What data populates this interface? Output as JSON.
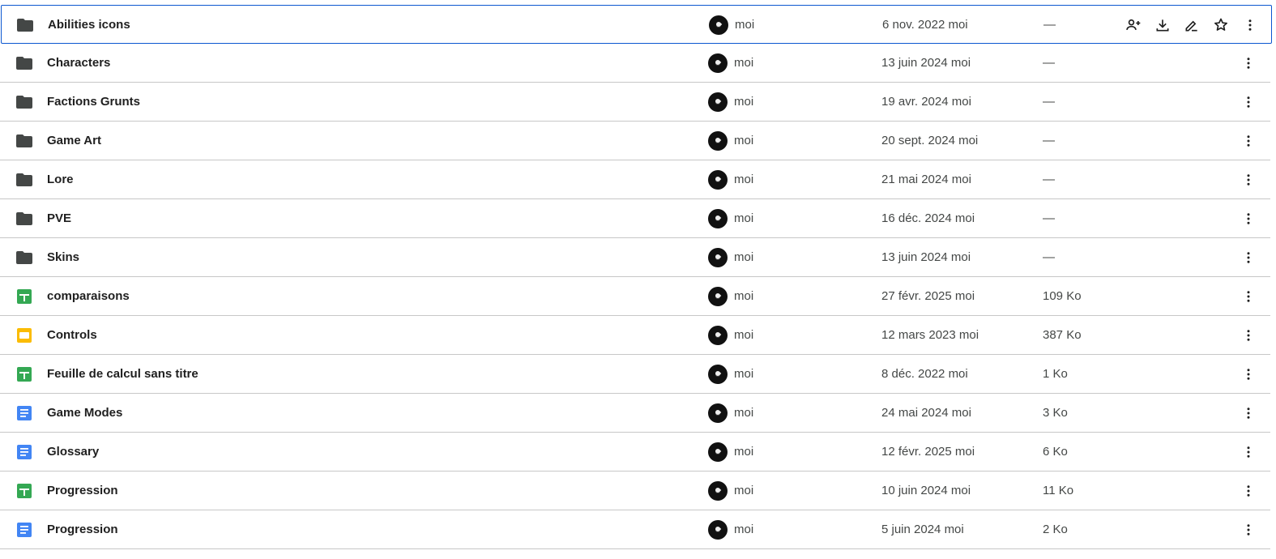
{
  "colors": {
    "folder": "#444746",
    "sheets": "#34a853",
    "slides": "#fbbc04",
    "docs": "#4285f4",
    "selection_border": "#0b57d0"
  },
  "rows": [
    {
      "name": "Abilities icons",
      "type": "folder-icon",
      "owner": "moi",
      "modified": "6 nov. 2022 moi",
      "size": "—",
      "selected": true
    },
    {
      "name": "Characters",
      "type": "folder-icon",
      "owner": "moi",
      "modified": "13 juin 2024 moi",
      "size": "—"
    },
    {
      "name": "Factions Grunts",
      "type": "folder-icon",
      "owner": "moi",
      "modified": "19 avr. 2024 moi",
      "size": "—"
    },
    {
      "name": "Game Art",
      "type": "folder-icon",
      "owner": "moi",
      "modified": "20 sept. 2024 moi",
      "size": "—"
    },
    {
      "name": "Lore",
      "type": "folder-icon",
      "owner": "moi",
      "modified": "21 mai 2024 moi",
      "size": "—"
    },
    {
      "name": "PVE",
      "type": "folder-icon",
      "owner": "moi",
      "modified": "16 déc. 2024 moi",
      "size": "—"
    },
    {
      "name": "Skins",
      "type": "folder-icon",
      "owner": "moi",
      "modified": "13 juin 2024 moi",
      "size": "—"
    },
    {
      "name": "comparaisons",
      "type": "sheets-icon",
      "owner": "moi",
      "modified": "27 févr. 2025 moi",
      "size": "109 Ko"
    },
    {
      "name": "Controls",
      "type": "slides-icon",
      "owner": "moi",
      "modified": "12 mars 2023 moi",
      "size": "387 Ko"
    },
    {
      "name": "Feuille de calcul sans titre",
      "type": "sheets-icon",
      "owner": "moi",
      "modified": "8 déc. 2022 moi",
      "size": "1 Ko"
    },
    {
      "name": "Game Modes",
      "type": "docs-icon",
      "owner": "moi",
      "modified": "24 mai 2024 moi",
      "size": "3 Ko"
    },
    {
      "name": "Glossary",
      "type": "docs-icon",
      "owner": "moi",
      "modified": "12 févr. 2025 moi",
      "size": "6 Ko"
    },
    {
      "name": "Progression",
      "type": "sheets-icon",
      "owner": "moi",
      "modified": "10 juin 2024 moi",
      "size": "11 Ko"
    },
    {
      "name": "Progression",
      "type": "docs-icon",
      "owner": "moi",
      "modified": "5 juin 2024 moi",
      "size": "2 Ko"
    }
  ],
  "hover_actions": [
    "share-icon",
    "download-icon",
    "rename-icon",
    "star-icon"
  ]
}
